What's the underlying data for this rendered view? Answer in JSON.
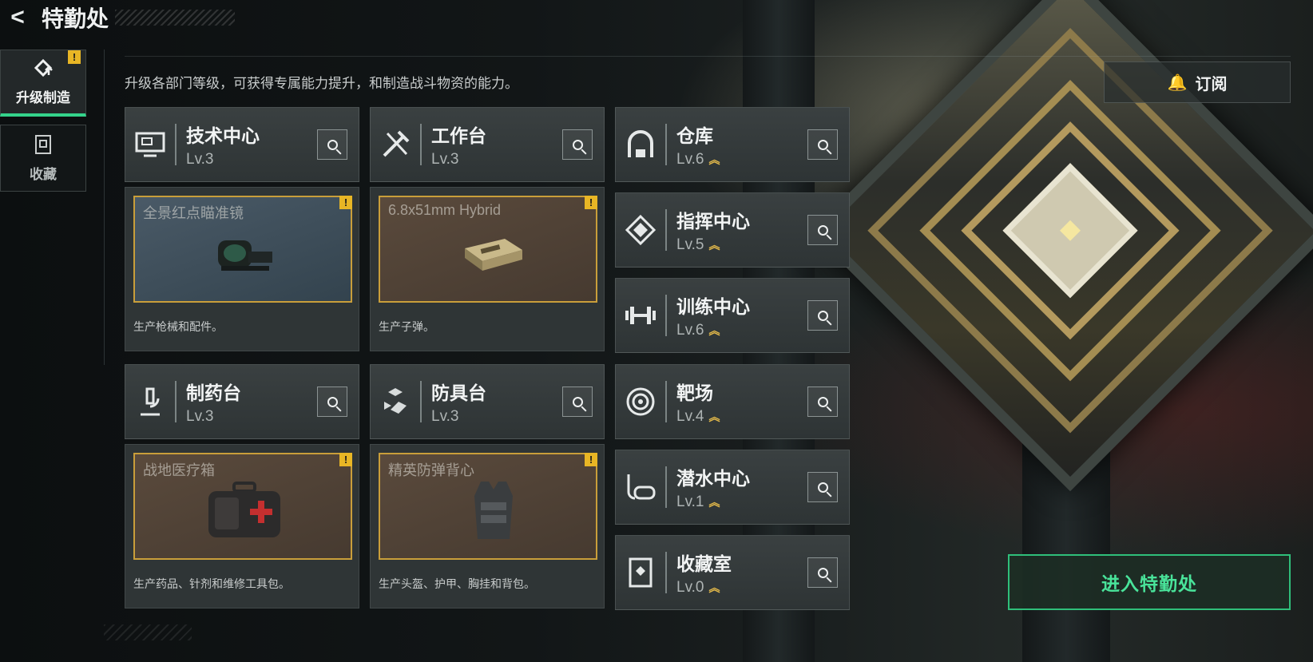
{
  "header": {
    "back_glyph": "<",
    "title": "特勤处"
  },
  "nav": [
    {
      "label": "升级制造",
      "icon": "upgrade-icon",
      "warn": "!"
    },
    {
      "label": "收藏",
      "icon": "collection-icon"
    }
  ],
  "description": "升级各部门等级，可获得专属能力提升，和制造战斗物资的能力。",
  "subscribe": {
    "label": "订阅",
    "icon": "bell-icon"
  },
  "departments": [
    {
      "name": "技术中心",
      "level": "Lv.3",
      "icon": "computer-icon"
    },
    {
      "name": "工作台",
      "level": "Lv.3",
      "icon": "tools-icon"
    },
    {
      "name": "仓库",
      "level": "Lv.6",
      "icon": "warehouse-icon"
    },
    {
      "name": "指挥中心",
      "level": "Lv.5",
      "icon": "command-icon"
    },
    {
      "name": "训练中心",
      "level": "Lv.6",
      "icon": "dumbbell-icon"
    },
    {
      "name": "制药台",
      "level": "Lv.3",
      "icon": "microscope-icon"
    },
    {
      "name": "防具台",
      "level": "Lv.3",
      "icon": "cubes-icon"
    },
    {
      "name": "靶场",
      "level": "Lv.4",
      "icon": "target-icon"
    },
    {
      "name": "潜水中心",
      "level": "Lv.1",
      "icon": "diving-mask-icon"
    },
    {
      "name": "收藏室",
      "level": "Lv.0",
      "icon": "display-case-icon"
    }
  ],
  "production": [
    {
      "item": "全景红点瞄准镜",
      "desc": "生产枪械和配件。",
      "warn": "!"
    },
    {
      "item": "6.8x51mm Hybrid",
      "desc": "生产子弹。",
      "warn": "!"
    },
    {
      "item": "战地医疗箱",
      "desc": "生产药品、针剂和维修工具包。",
      "warn": "!"
    },
    {
      "item": "精英防弹背心",
      "desc": "生产头盔、护甲、胸挂和背包。",
      "warn": "!"
    }
  ],
  "enter_button": "进入特勤处",
  "level_chevron": "︽",
  "colors": {
    "accent_green": "#34d38b",
    "warning_yellow": "#e8b625",
    "level_gold": "#e6bb4a",
    "frame_gold": "#c99e3a"
  }
}
